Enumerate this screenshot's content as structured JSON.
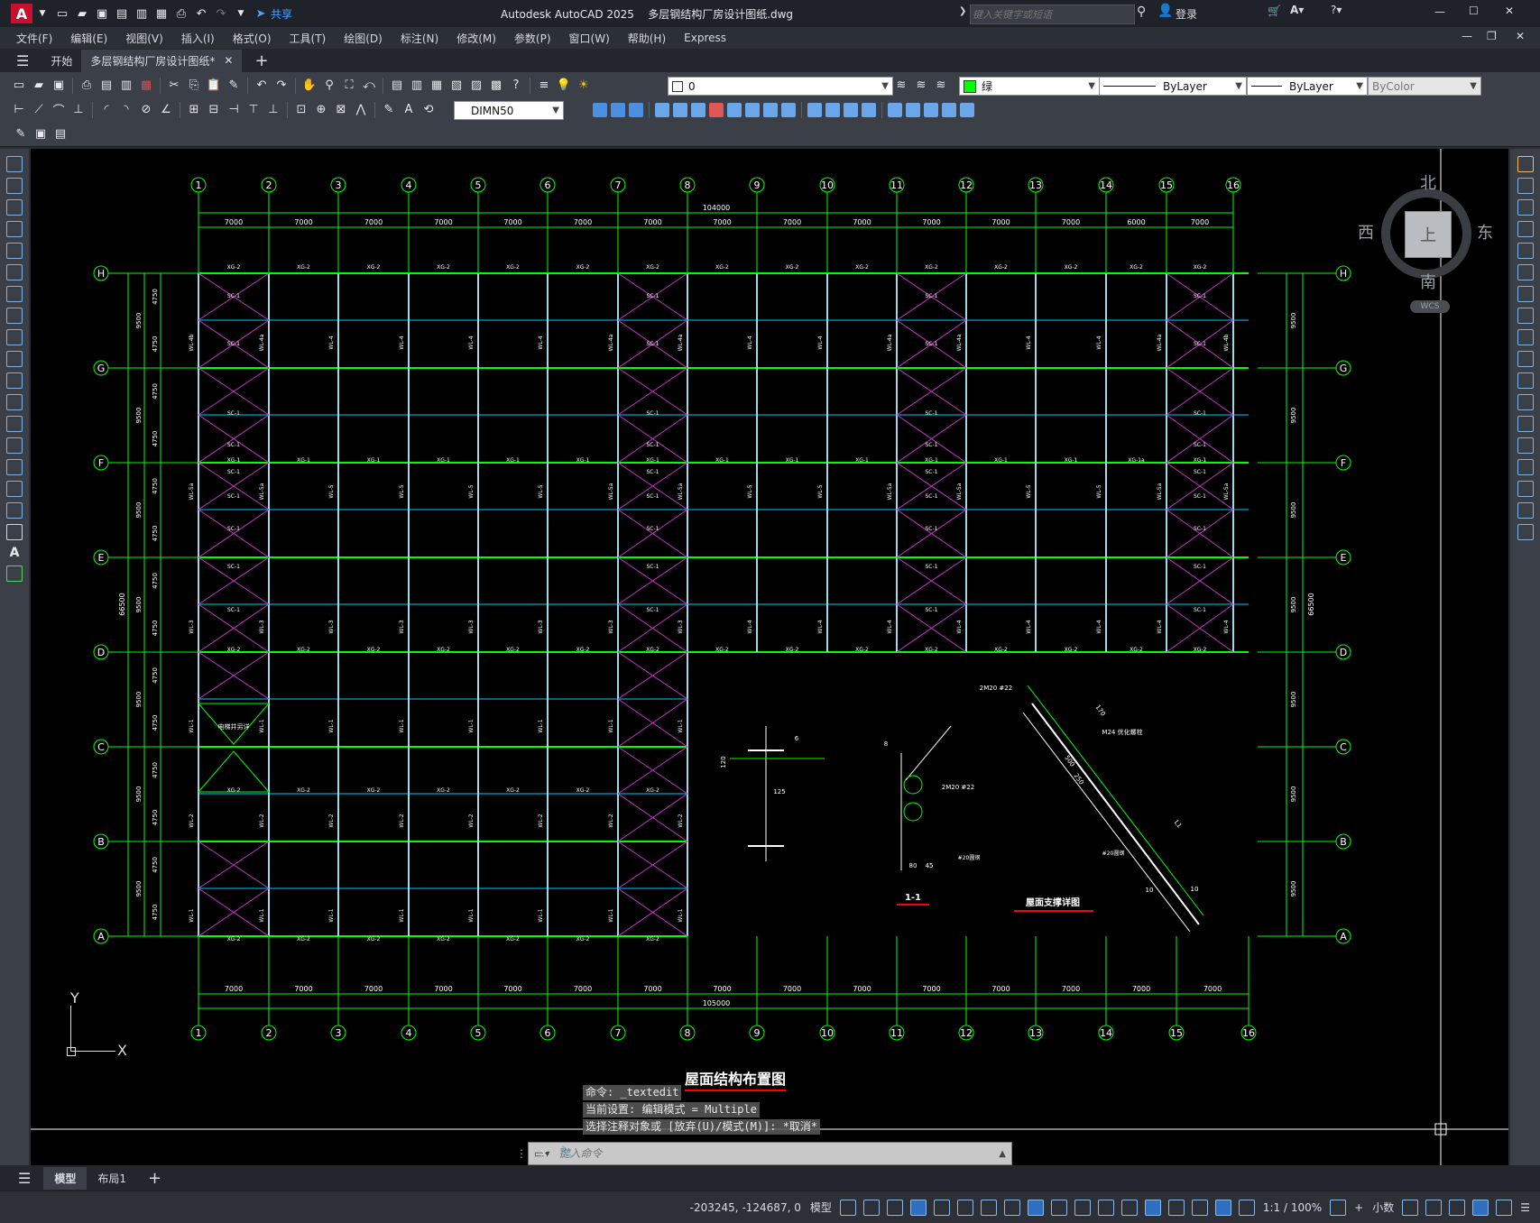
{
  "app": {
    "logo": "A",
    "title": "Autodesk AutoCAD 2025",
    "file": "多层钢结构厂房设计图纸.dwg",
    "share": "共享",
    "search_placeholder": "键入关键字或短语",
    "login": "登录",
    "window_controls": [
      "—",
      "☐",
      "✕"
    ]
  },
  "menu": [
    "文件(F)",
    "编辑(E)",
    "视图(V)",
    "插入(I)",
    "格式(O)",
    "工具(T)",
    "绘图(D)",
    "标注(N)",
    "修改(M)",
    "参数(P)",
    "窗口(W)",
    "帮助(H)",
    "Express"
  ],
  "tabs": {
    "start": "开始",
    "doc": "多层钢结构厂房设计图纸*",
    "add": "+"
  },
  "properties": {
    "layer": "0",
    "color": "绿",
    "color_hex": "#00ff00",
    "linetype": "ByLayer",
    "lineweight": "ByLayer",
    "plotstyle": "ByColor",
    "dimstyle": "DIMN50"
  },
  "viewcube": {
    "north": "北",
    "south": "南",
    "east": "东",
    "west": "西",
    "top": "上",
    "wcs": "WCS"
  },
  "drawing": {
    "title": "屋面结构布置图",
    "detail_title": "屋面支撑详图",
    "section_label": "1-1",
    "top_columns": [
      "1",
      "2",
      "3",
      "4",
      "5",
      "6",
      "7",
      "8",
      "9",
      "10",
      "11",
      "12",
      "13",
      "14",
      "15",
      "16"
    ],
    "bottom_columns": [
      "1",
      "2",
      "3",
      "4",
      "5",
      "6",
      "7",
      "8",
      "9",
      "10",
      "11",
      "12",
      "13",
      "14",
      "15",
      "16"
    ],
    "rows": [
      "H",
      "G",
      "F",
      "E",
      "D",
      "C",
      "B",
      "A"
    ],
    "top_bays": [
      "7000",
      "7000",
      "7000",
      "7000",
      "7000",
      "7000",
      "7000",
      "7000",
      "7000",
      "7000",
      "7000",
      "7000",
      "7000",
      "6000",
      "7000"
    ],
    "top_total": "104000",
    "bottom_bays": [
      "7000",
      "7000",
      "7000",
      "7000",
      "7000",
      "7000",
      "7000",
      "7000",
      "7000",
      "7000",
      "7000",
      "7000",
      "7000",
      "7000",
      "7000"
    ],
    "bottom_total": "105000",
    "side_total": "66500",
    "row_spacing": "9500",
    "half_spacing": "4750",
    "labels": {
      "xg2": "XG-2",
      "xg1": "XG-1",
      "xg1a": "XG-1a",
      "sc1": "SC-1",
      "wl4": "WL-4",
      "wl4a": "WL-4a",
      "wl4b": "WL-4b",
      "wl5": "WL-5",
      "wl5a": "WL-5a",
      "wl3": "WL-3",
      "wl2": "WL-2",
      "wl1": "WL-1",
      "shaft": "电梯井另详"
    },
    "detail": {
      "bolt1": "2M20 #22",
      "bolt2": "M24 优化螺栓",
      "bolt3": "2M20 #22",
      "rod": "#20圆钢",
      "rod2": "#20圆钢",
      "d120": "120",
      "d125": "125",
      "d6": "6",
      "d8": "8",
      "d10": "10",
      "d80": "80",
      "d45": "45",
      "d170": "170",
      "d250": "250",
      "d500": "500",
      "dL1": "L1"
    }
  },
  "ucs": {
    "x": "X",
    "y": "Y"
  },
  "command": {
    "lines": [
      "命令: _textedit",
      "当前设置: 编辑模式 = Multiple",
      "选择注释对象或 [放弃(U)/模式(M)]: *取消*"
    ],
    "placeholder": "键入命令"
  },
  "layout_tabs": [
    "模型",
    "布局1"
  ],
  "status": {
    "coords": "-203245, -124687, 0",
    "model": "模型",
    "scale": "1:1 / 100%",
    "units": "小数"
  }
}
